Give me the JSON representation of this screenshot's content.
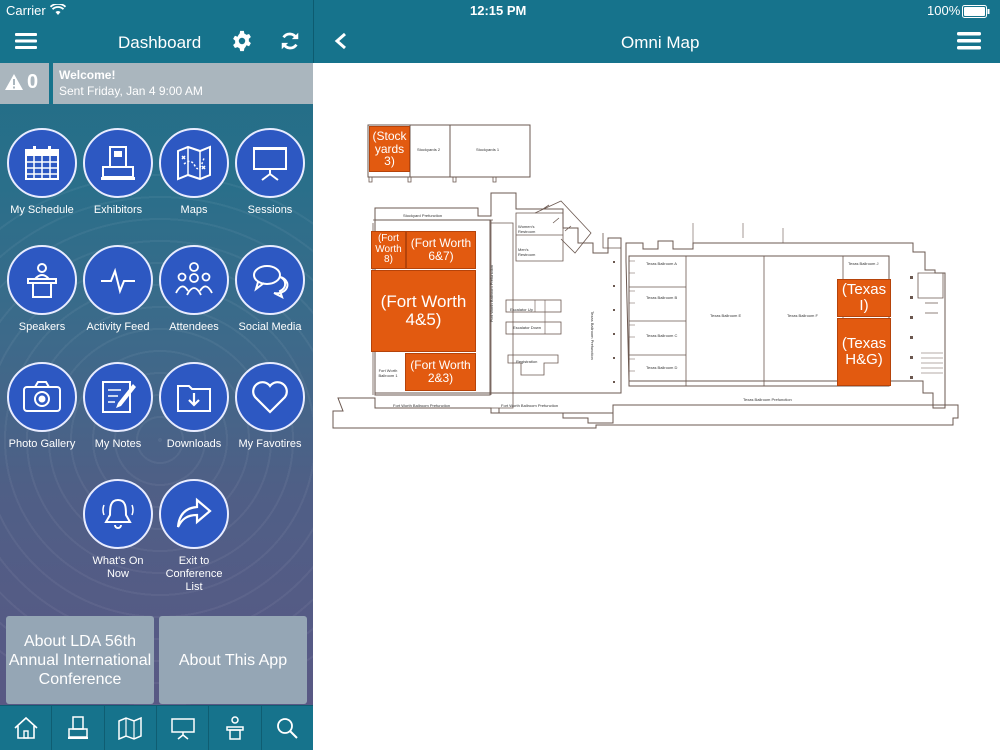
{
  "status_bar": {
    "carrier": "Carrier",
    "time": "12:15 PM",
    "battery": "100%"
  },
  "left_header": {
    "title": "Dashboard"
  },
  "right_header": {
    "title": "Omni Map"
  },
  "alert": {
    "count": "0",
    "title": "Welcome!",
    "subtitle": "Sent Friday, Jan 4 9:00 AM"
  },
  "tiles": [
    {
      "label": "My Schedule",
      "icon": "calendar-icon"
    },
    {
      "label": "Exhibitors",
      "icon": "booth-icon"
    },
    {
      "label": "Maps",
      "icon": "map-icon"
    },
    {
      "label": "Sessions",
      "icon": "presentation-board-icon"
    },
    {
      "label": "Speakers",
      "icon": "podium-icon"
    },
    {
      "label": "Activity Feed",
      "icon": "pulse-icon"
    },
    {
      "label": "Attendees",
      "icon": "people-icon"
    },
    {
      "label": "Social Media",
      "icon": "chat-bubbles-icon"
    },
    {
      "label": "Photo Gallery",
      "icon": "camera-icon"
    },
    {
      "label": "My Notes",
      "icon": "notepad-icon"
    },
    {
      "label": "Downloads",
      "icon": "download-folder-icon"
    },
    {
      "label": "My Favotires",
      "icon": "heart-icon"
    },
    {
      "label": "What's On Now",
      "icon": "bell-icon"
    },
    {
      "label": "Exit to Conference List",
      "icon": "share-arrow-icon"
    }
  ],
  "buttons": {
    "about_lda": "About LDA 56th Annual International Conference",
    "about_app": "About This App"
  },
  "tabbar": [
    "home-icon",
    "booth-icon",
    "map-icon",
    "presentation-board-icon",
    "podium-icon",
    "search-icon"
  ],
  "map": {
    "rooms": {
      "stockyards3": "(Stock yards 3)",
      "fw8": "(Fort Worth 8)",
      "fw67": "(Fort Worth 6&7)",
      "fw45": "(Fort Worth 4&5)",
      "fw23": "(Fort Worth 2&3)",
      "texasI": "(Texas I)",
      "texasHG": "(Texas H&G)"
    },
    "labels": {
      "stockyards2": "Stockyards 2",
      "stockyards1": "Stockyards 1",
      "stockyard_prefunction": "Stockyard Prefunction",
      "fw_ballroom_prefunction": "Fort Worth Ballroom Prefunction",
      "fw_ballroom_prefunction_v": "Fort Worth Ballroom Prefunction",
      "fw_ballroom1": "Fort Worth Ballroom 1",
      "womens": "Women's Restroom",
      "mens": "Men's Restroom",
      "escalator_up": "Escalator Up",
      "escalator_down": "Escalator Down",
      "registration": "Registration",
      "texas_prefunction_v": "Texas Ballroom Prefunction",
      "texasA": "Texas Ballroom A",
      "texasB": "Texas Ballroom B",
      "texasC": "Texas Ballroom C",
      "texasD": "Texas Ballroom D",
      "texasE": "Texas Ballroom E",
      "texasF": "Texas Ballroom F",
      "texasJ": "Texas Ballroom J",
      "texas_prefunction": "Texas Ballroom Prefunction"
    }
  },
  "colors": {
    "header": "#16738c",
    "tile_fill": "#2d58c2",
    "room_highlight": "#e25a10"
  }
}
